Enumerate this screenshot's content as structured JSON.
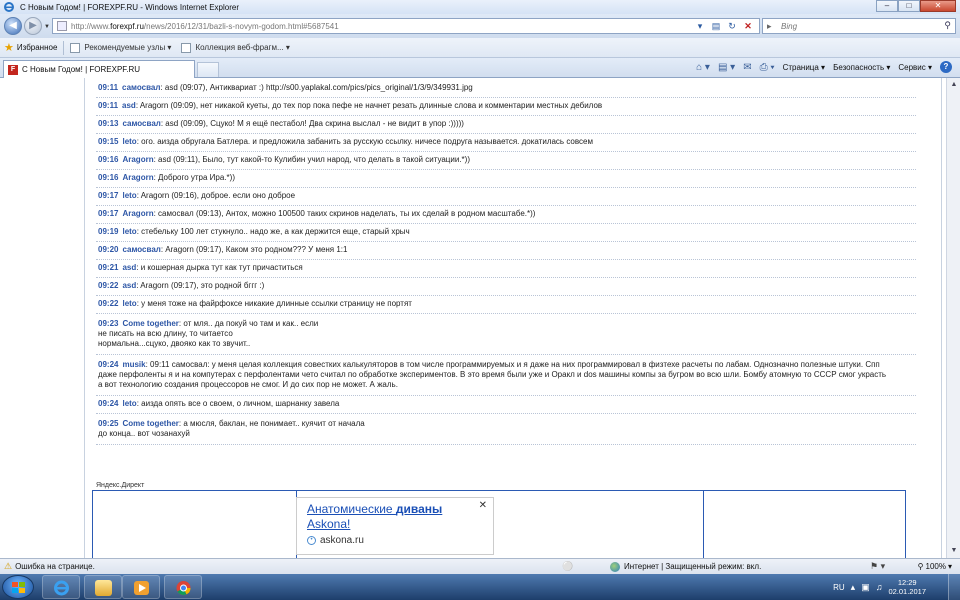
{
  "window": {
    "title": "С Новым Годом! | FOREXPF.RU - Windows Internet Explorer",
    "minimize": "–",
    "maximize": "□",
    "close": "✕"
  },
  "address": {
    "url_prefix": "http://www.",
    "url_domain": "forexpf.ru",
    "url_path": "/news/2016/12/31/bazli-s-novym-godom.html#5687541",
    "search_placeholder": "Bing"
  },
  "favorites": {
    "main_label": "Избранное",
    "items": [
      {
        "label": "Рекомендуемые узлы ▾"
      },
      {
        "label": "Коллекция веб-фрагм... ▾"
      }
    ]
  },
  "tab": {
    "title": "С Новым Годом! | FOREXPF.RU"
  },
  "command_bar": {
    "page": "Страница ▾",
    "safety": "Безопасность ▾",
    "tools": "Сервис ▾",
    "help": "?"
  },
  "chat": {
    "messages": [
      {
        "time": "09:11",
        "nick": "самосвал",
        "text": ": asd (09:07), Антиквариат :) http://s00.yaplakal.com/pics/pics_original/1/3/9/349931.jpg"
      },
      {
        "time": "09:11",
        "nick": "asd",
        "text": ": Aragorn (09:09), нет никакой куеты, до тех пор пока пефе не начнет резать длинные слова и комментарии местных дебилов"
      },
      {
        "time": "09:13",
        "nick": "самосвал",
        "text": ": asd (09:09), Сцуко! М я ещё пестабол! Два скрина выслал - не видит в упор :)))))"
      },
      {
        "time": "09:15",
        "nick": "leto",
        "text": ": ого. аизда обругала Батлера. и предложила забанить за русскую ссылку. ничесе подруга называется. докатилась совсем"
      },
      {
        "time": "09:16",
        "nick": "Aragorn",
        "text": ": asd (09:11), Было, тут какой-то Кулибин учил народ, что делать в такой ситуации.*))"
      },
      {
        "time": "09:16",
        "nick": "Aragorn",
        "text": ": Доброго утра Ира.*))"
      },
      {
        "time": "09:17",
        "nick": "leto",
        "text": ": Aragorn (09:16), доброе. если оно доброе"
      },
      {
        "time": "09:17",
        "nick": "Aragorn",
        "text": ": самосвал (09:13), Антох, можно 100500 таких скринов наделать, ты их сделай в родном масштабе.*))"
      },
      {
        "time": "09:19",
        "nick": "leto",
        "text": ": стебельку 100 лет стукнуло.. надо же, а как держится еще, старый хрыч"
      },
      {
        "time": "09:20",
        "nick": "самосвал",
        "text": ": Aragorn (09:17), Каком это родном??? У меня 1:1"
      },
      {
        "time": "09:21",
        "nick": "asd",
        "text": ": и кошерная дырка тут как тут причаститься"
      },
      {
        "time": "09:22",
        "nick": "asd",
        "text": ": Aragorn (09:17), это родной бггг :)"
      },
      {
        "time": "09:22",
        "nick": "leto",
        "text": ": у меня тоже на файрфоксе никакие длинные ссылки страницу не портят"
      },
      {
        "time": "09:23",
        "nick": "Come together",
        "text": ": от мля.. да покуй чо там и как.. если",
        "cont": [
          "не писать на всю длину, то читаетсо",
          "нормальна...сцуко, двояко как то звучит.."
        ]
      },
      {
        "time": "09:24",
        "nick": "musik",
        "text": ": 09:11 самосвал: у меня целая коллекция совестких калькуляторов в том числе программируемых и я даже на них программировал в физтехе расчеты по лабам. Однозначно полезные штуки. Cпп",
        "cont": [
          "даже перфоленты я и на компутерах с перфолентами чето считал по обработке экспериментов. В это время были уже и Оракл и dos машины компы за бугром во всю шли. Бомбу атомную то СССР смог украсть",
          "а вот технологию создания процессоров не смог. И до сих пор не может. А жаль."
        ]
      },
      {
        "time": "09:24",
        "nick": "leto",
        "text": ": аизда опять все о своем, о личном, шарнанку завела"
      },
      {
        "time": "09:25",
        "nick": "Come together",
        "text": ": а мюсля, баклан, не понимает.. куячит от начала",
        "cont": [
          "до конца.. вот чозанахуй"
        ]
      }
    ]
  },
  "ads": {
    "label": "Яндекс.Директ",
    "title_plain": "Анатомические ",
    "title_bold": "диваны",
    "title_line2": "Askona!",
    "close": "✕",
    "domain": "askona.ru"
  },
  "status": {
    "error_text": "Ошибка на странице.",
    "zone_text": "Интернет | Защищенный режим: вкл.",
    "zoom": "100%"
  },
  "taskbar": {
    "lang": "RU",
    "time": "12:29",
    "date": "02.01.2017"
  },
  "colors": {
    "link_blue": "#2d56a6",
    "ad_border": "#2b5ab3"
  }
}
